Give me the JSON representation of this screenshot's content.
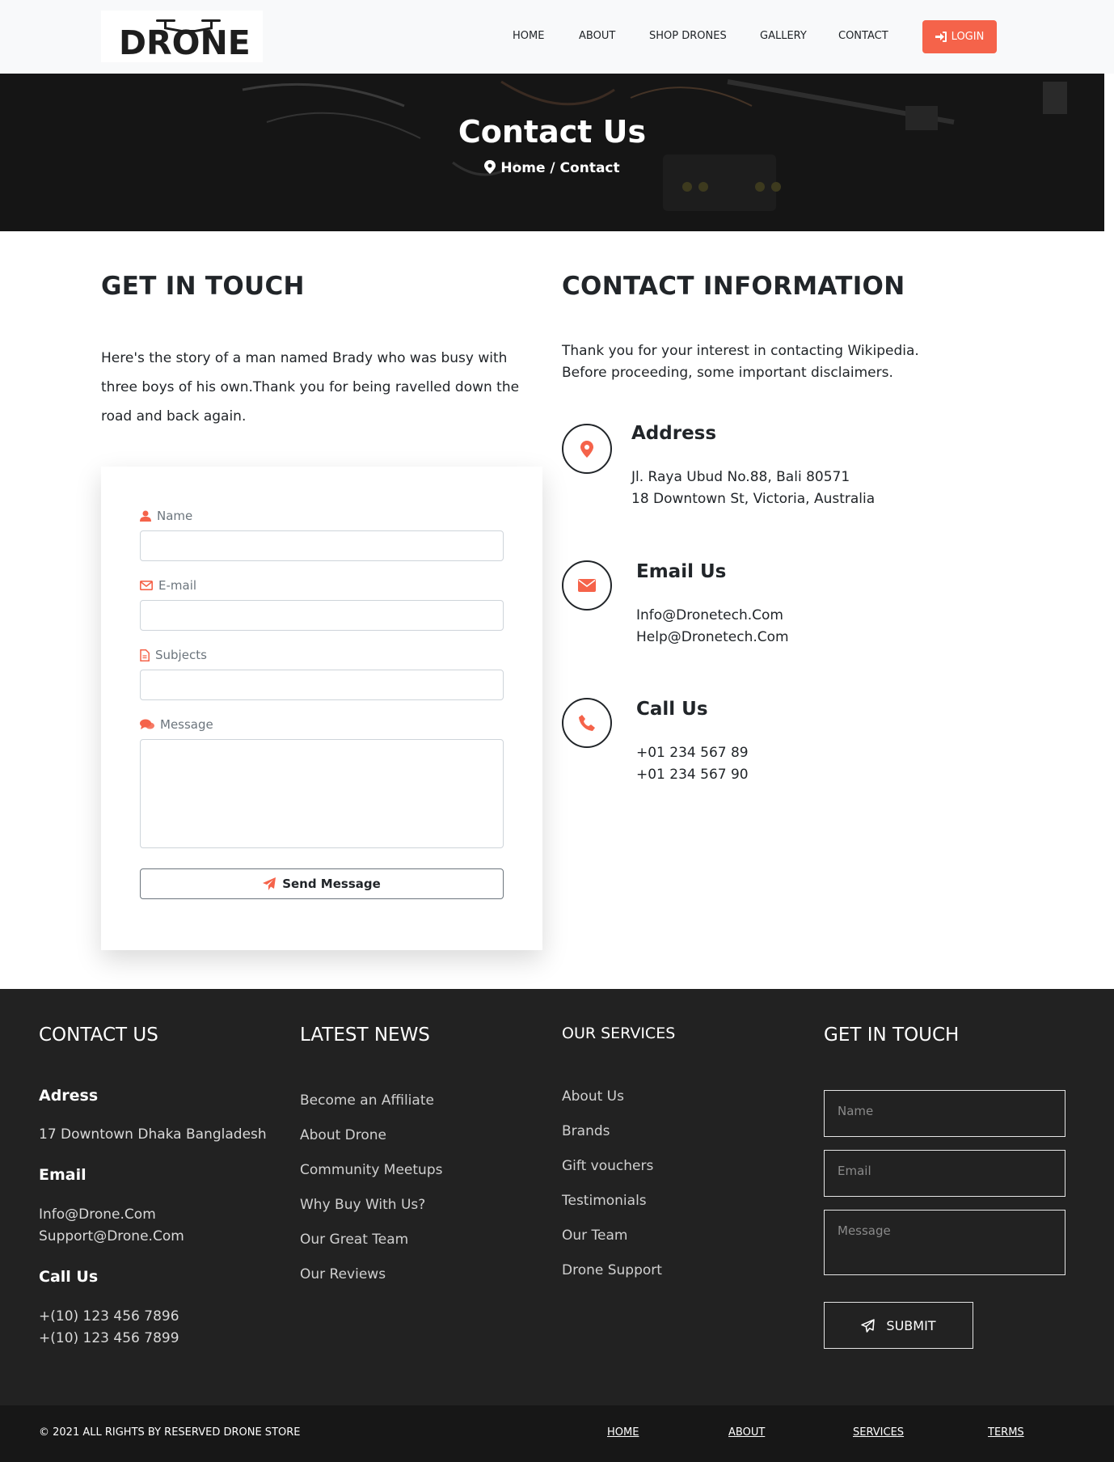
{
  "nav": {
    "logo_text": "DRONE",
    "links": [
      "HOME",
      "ABOUT",
      "SHOP DRONES",
      "GALLERY",
      "CONTACT"
    ],
    "login_label": "LOGIN"
  },
  "hero": {
    "title": "Contact Us",
    "breadcrumb": "Home / Contact"
  },
  "get_in_touch": {
    "heading": "GET IN TOUCH",
    "text": "Here's the story of a man named Brady who was busy with three boys of his own.Thank you for being ravelled down the road and back again."
  },
  "form": {
    "name_label": "Name",
    "email_label": "E-mail",
    "subjects_label": "Subjects",
    "message_label": "Message",
    "send_label": "Send Message"
  },
  "contact_info": {
    "heading": "CONTACT INFORMATION",
    "text": "Thank you for your interest in contacting Wikipedia. Before proceeding, some important disclaimers.",
    "address_title": "Address",
    "address_lines": [
      "Jl. Raya Ubud No.88, Bali 80571",
      "18 Downtown St, Victoria, Australia"
    ],
    "email_title": "Email Us",
    "email_lines": [
      "Info@Dronetech.Com",
      "Help@Dronetech.Com"
    ],
    "call_title": "Call Us",
    "call_lines": [
      "+01 234 567 89",
      "+01 234 567 90"
    ]
  },
  "footer": {
    "contact": {
      "heading": "CONTACT US",
      "address_title": "Adress",
      "address": "17 Downtown Dhaka Bangladesh",
      "email_title": "Email",
      "emails": [
        "Info@Drone.Com",
        "Support@Drone.Com"
      ],
      "call_title": "Call Us",
      "phones": [
        "+(10) 123 456 7896",
        "+(10) 123 456 7899"
      ]
    },
    "news": {
      "heading": "LATEST NEWS",
      "items": [
        "Become an Affiliate",
        "About Drone",
        "Community Meetups",
        "Why Buy With Us?",
        "Our Great Team",
        "Our Reviews"
      ]
    },
    "services": {
      "heading": "OUR SERVICES",
      "items": [
        "About Us",
        "Brands",
        "Gift vouchers",
        "Testimonials",
        "Our Team",
        "Drone Support"
      ]
    },
    "touch": {
      "heading": "GET IN TOUCH",
      "name_placeholder": "Name",
      "email_placeholder": "Email",
      "message_placeholder": "Message",
      "submit_label": "SUBMIT"
    }
  },
  "bottom": {
    "copyright": "© 2021 ALL RIGHTS BY RESERVED DRONE STORE",
    "links": [
      "HOME",
      "ABOUT",
      "SERVICES",
      "TERMS"
    ]
  },
  "colors": {
    "accent": "#f5634a",
    "footer_bg": "#222222",
    "bottom_bg": "#171717"
  }
}
